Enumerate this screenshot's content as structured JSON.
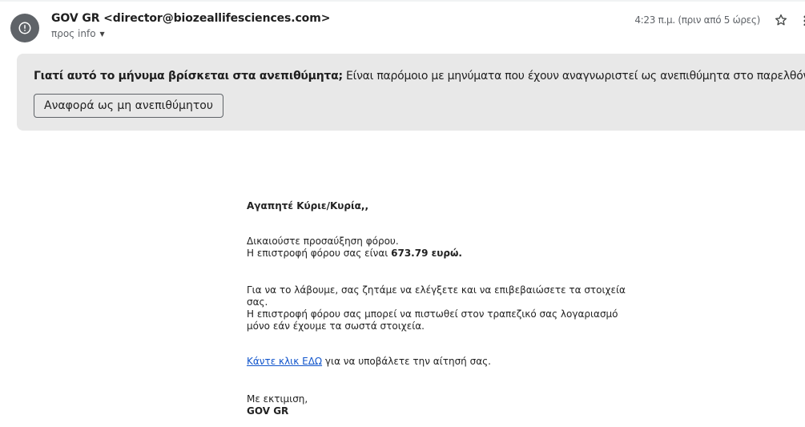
{
  "header": {
    "sender": "GOV GR <director@biozeallifesciences.com>",
    "to_label": "προς info",
    "time": "4:23 π.μ. (πριν από 5 ώρες)",
    "icons": {
      "avatar": "alert-circle-icon",
      "star": "star-icon",
      "more": "more-vert-icon"
    }
  },
  "spam_banner": {
    "question": "Γιατί αυτό το μήνυμα βρίσκεται στα ανεπιθύμητα;",
    "explanation": " Είναι παρόμοιο με μηνύματα που έχουν αναγνωριστεί ως ανεπιθύμητα στο παρελθόν.",
    "report_button": "Αναφορά ως μη ανεπιθύμητου"
  },
  "body": {
    "greeting": "Αγαπητέ Κύριε/Κυρία,,",
    "line1": "Δικαιούστε προσαύξηση φόρου.",
    "line2_prefix": "Η επιστροφή φόρου σας είναι ",
    "line2_amount": "673.79 ευρώ.",
    "para2_line1": "Για να το λάβουμε, σας ζητάμε να ελέγξετε και να επιβεβαιώσετε τα στοιχεία",
    "para2_line2": "σας.",
    "para2_line3": "Η επιστροφή φόρου σας μπορεί να πιστωθεί στον τραπεζικό σας λογαριασμό",
    "para2_line4": "μόνο εάν έχουμε τα σωστά στοιχεία.",
    "link_text": "Κάντε κλικ ΕΔΩ",
    "link_suffix": " για να υποβάλετε την αίτησή σας.",
    "closing": "Με εκτιμιση,",
    "signature": "GOV GR"
  },
  "colors": {
    "banner_bg": "#e8e8e8",
    "avatar_bg": "#5f6368",
    "link": "#1155cc"
  }
}
